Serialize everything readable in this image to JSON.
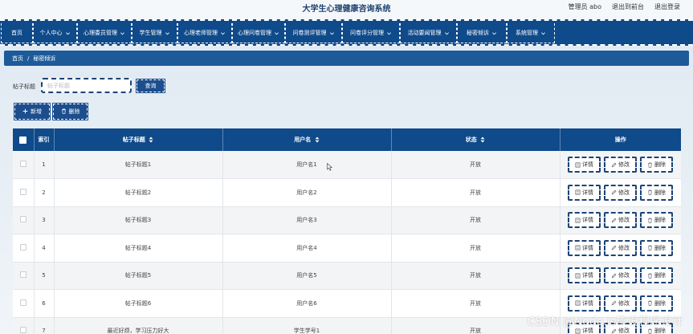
{
  "header": {
    "site_title": "大学生心理健康咨询系统",
    "admin_label": "管理员 abo",
    "front_link": "退出到前台",
    "logout_link": "退出登录"
  },
  "nav": {
    "items": [
      {
        "label": "首页",
        "dropdown": false
      },
      {
        "label": "个人中心",
        "dropdown": true
      },
      {
        "label": "心理委员管理",
        "dropdown": true
      },
      {
        "label": "学生管理",
        "dropdown": true
      },
      {
        "label": "心理老师管理",
        "dropdown": true
      },
      {
        "label": "心理问卷管理",
        "dropdown": true
      },
      {
        "label": "问卷测评管理",
        "dropdown": true
      },
      {
        "label": "问卷评分管理",
        "dropdown": true
      },
      {
        "label": "活动要闻管理",
        "dropdown": true
      },
      {
        "label": "秘密倾诉",
        "dropdown": true
      },
      {
        "label": "系统管理",
        "dropdown": true
      }
    ]
  },
  "breadcrumb": {
    "home": "首页",
    "separator": "/",
    "current": "秘密倾诉"
  },
  "search": {
    "label": "帖子标题",
    "placeholder": "帖子标题",
    "value": "",
    "button": "查询"
  },
  "actions": {
    "add": "新增",
    "delete": "删除"
  },
  "table": {
    "headers": {
      "index": "索引",
      "title": "帖子标题",
      "username": "用户名",
      "status": "状态",
      "ops": "操作"
    },
    "op_labels": {
      "detail": "详情",
      "edit": "修改",
      "delete": "删除"
    },
    "rows": [
      {
        "index": "1",
        "title": "帖子标题1",
        "username": "用户名1",
        "status": "开放"
      },
      {
        "index": "2",
        "title": "帖子标题2",
        "username": "用户名2",
        "status": "开放"
      },
      {
        "index": "3",
        "title": "帖子标题3",
        "username": "用户名3",
        "status": "开放"
      },
      {
        "index": "4",
        "title": "帖子标题4",
        "username": "用户名4",
        "status": "开放"
      },
      {
        "index": "5",
        "title": "帖子标题5",
        "username": "用户名5",
        "status": "开放"
      },
      {
        "index": "6",
        "title": "帖子标题6",
        "username": "用户名6",
        "status": "开放"
      },
      {
        "index": "7",
        "title": "最近好烦，学习压力好大",
        "username": "学生学号1",
        "status": "开放"
      }
    ]
  },
  "watermark": "CSDN @Node.js毕设程序设计",
  "colors": {
    "primary": "#0f4a8a",
    "breadcrumb": "#1d5a9a",
    "accent_border": "#1c4476"
  }
}
